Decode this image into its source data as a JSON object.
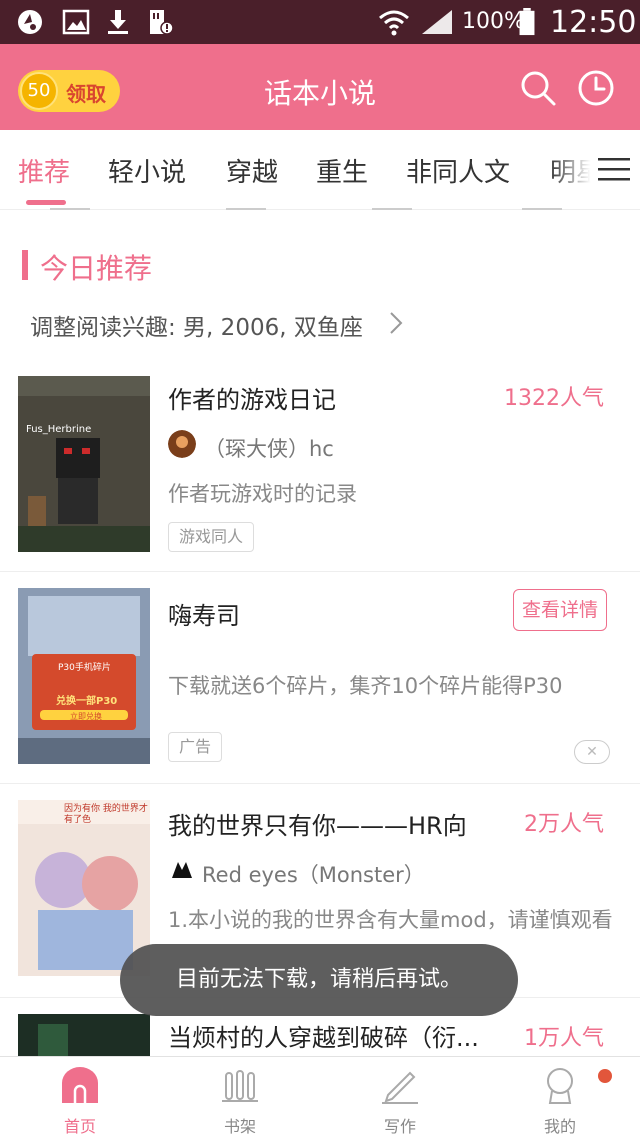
{
  "status_bar": {
    "battery_percent": "100%",
    "time": "12:50",
    "icons": [
      "browser-icon",
      "image-icon",
      "download-icon",
      "sd-card-warning-icon",
      "wifi-icon",
      "cellular-signal-icon",
      "battery-icon"
    ]
  },
  "header": {
    "reward_count": "50",
    "reward_label": "领取",
    "title": "话本小说",
    "icons": [
      "search-icon",
      "history-clock-icon"
    ]
  },
  "tabs": [
    {
      "label": "推荐",
      "active": true
    },
    {
      "label": "轻小说",
      "active": false
    },
    {
      "label": "穿越",
      "active": false
    },
    {
      "label": "重生",
      "active": false
    },
    {
      "label": "非同人文",
      "active": false
    },
    {
      "label": "明星",
      "active": false
    }
  ],
  "section": {
    "title": "今日推荐",
    "preference": "调整阅读兴趣: 男, 2006, 双鱼座"
  },
  "books": [
    {
      "title": "作者的游戏日记",
      "popularity": "1322人气",
      "author": "（琛大侠）hc",
      "description": "作者玩游戏时的记录",
      "tag": "游戏同人",
      "cover_text": "Fus_Herbrine"
    },
    {
      "title": "我的世界只有你———HR向",
      "popularity": "2万人气",
      "author": "Red eyes（Monster）",
      "description": "1.本小说的我的世界含有大量mod，请谨慎观看",
      "cover_text": "因为有你 我的世界才有了色"
    },
    {
      "title": "当烦村的人穿越到破碎（衍...",
      "popularity": "1万人气"
    }
  ],
  "ad": {
    "title": "嗨寿司",
    "button": "查看详情",
    "description": "下载就送6个碎片，集齐10个碎片能得P30",
    "tag": "广告",
    "close": "✕",
    "cover_lines": [
      "P30手机碎片",
      "兑换一部P30",
      "立即兑换"
    ]
  },
  "toast": "目前无法下载，请稍后再试。",
  "bottom_nav": [
    {
      "label": "首页",
      "icon": "home-icon",
      "active": true
    },
    {
      "label": "书架",
      "icon": "bookshelf-icon",
      "active": false
    },
    {
      "label": "写作",
      "icon": "pencil-icon",
      "active": false
    },
    {
      "label": "我的",
      "icon": "profile-icon",
      "active": false
    }
  ],
  "colors": {
    "accent": "#ef6f8c",
    "status_bar": "#4a1f2a",
    "reward": "#ffd23f"
  }
}
